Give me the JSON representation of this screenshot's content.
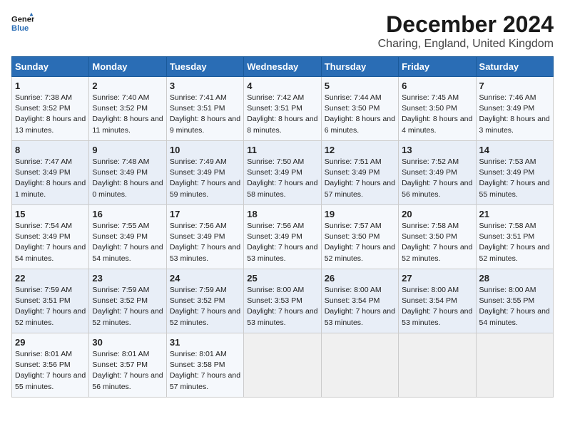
{
  "logo": {
    "line1": "General",
    "line2": "Blue"
  },
  "title": "December 2024",
  "location": "Charing, England, United Kingdom",
  "days_of_week": [
    "Sunday",
    "Monday",
    "Tuesday",
    "Wednesday",
    "Thursday",
    "Friday",
    "Saturday"
  ],
  "weeks": [
    [
      {
        "day": 1,
        "sunrise": "7:38 AM",
        "sunset": "3:52 PM",
        "daylight": "8 hours and 13 minutes."
      },
      {
        "day": 2,
        "sunrise": "7:40 AM",
        "sunset": "3:52 PM",
        "daylight": "8 hours and 11 minutes."
      },
      {
        "day": 3,
        "sunrise": "7:41 AM",
        "sunset": "3:51 PM",
        "daylight": "8 hours and 9 minutes."
      },
      {
        "day": 4,
        "sunrise": "7:42 AM",
        "sunset": "3:51 PM",
        "daylight": "8 hours and 8 minutes."
      },
      {
        "day": 5,
        "sunrise": "7:44 AM",
        "sunset": "3:50 PM",
        "daylight": "8 hours and 6 minutes."
      },
      {
        "day": 6,
        "sunrise": "7:45 AM",
        "sunset": "3:50 PM",
        "daylight": "8 hours and 4 minutes."
      },
      {
        "day": 7,
        "sunrise": "7:46 AM",
        "sunset": "3:49 PM",
        "daylight": "8 hours and 3 minutes."
      }
    ],
    [
      {
        "day": 8,
        "sunrise": "7:47 AM",
        "sunset": "3:49 PM",
        "daylight": "8 hours and 1 minute."
      },
      {
        "day": 9,
        "sunrise": "7:48 AM",
        "sunset": "3:49 PM",
        "daylight": "8 hours and 0 minutes."
      },
      {
        "day": 10,
        "sunrise": "7:49 AM",
        "sunset": "3:49 PM",
        "daylight": "7 hours and 59 minutes."
      },
      {
        "day": 11,
        "sunrise": "7:50 AM",
        "sunset": "3:49 PM",
        "daylight": "7 hours and 58 minutes."
      },
      {
        "day": 12,
        "sunrise": "7:51 AM",
        "sunset": "3:49 PM",
        "daylight": "7 hours and 57 minutes."
      },
      {
        "day": 13,
        "sunrise": "7:52 AM",
        "sunset": "3:49 PM",
        "daylight": "7 hours and 56 minutes."
      },
      {
        "day": 14,
        "sunrise": "7:53 AM",
        "sunset": "3:49 PM",
        "daylight": "7 hours and 55 minutes."
      }
    ],
    [
      {
        "day": 15,
        "sunrise": "7:54 AM",
        "sunset": "3:49 PM",
        "daylight": "7 hours and 54 minutes."
      },
      {
        "day": 16,
        "sunrise": "7:55 AM",
        "sunset": "3:49 PM",
        "daylight": "7 hours and 54 minutes."
      },
      {
        "day": 17,
        "sunrise": "7:56 AM",
        "sunset": "3:49 PM",
        "daylight": "7 hours and 53 minutes."
      },
      {
        "day": 18,
        "sunrise": "7:56 AM",
        "sunset": "3:49 PM",
        "daylight": "7 hours and 53 minutes."
      },
      {
        "day": 19,
        "sunrise": "7:57 AM",
        "sunset": "3:50 PM",
        "daylight": "7 hours and 52 minutes."
      },
      {
        "day": 20,
        "sunrise": "7:58 AM",
        "sunset": "3:50 PM",
        "daylight": "7 hours and 52 minutes."
      },
      {
        "day": 21,
        "sunrise": "7:58 AM",
        "sunset": "3:51 PM",
        "daylight": "7 hours and 52 minutes."
      }
    ],
    [
      {
        "day": 22,
        "sunrise": "7:59 AM",
        "sunset": "3:51 PM",
        "daylight": "7 hours and 52 minutes."
      },
      {
        "day": 23,
        "sunrise": "7:59 AM",
        "sunset": "3:52 PM",
        "daylight": "7 hours and 52 minutes."
      },
      {
        "day": 24,
        "sunrise": "7:59 AM",
        "sunset": "3:52 PM",
        "daylight": "7 hours and 52 minutes."
      },
      {
        "day": 25,
        "sunrise": "8:00 AM",
        "sunset": "3:53 PM",
        "daylight": "7 hours and 53 minutes."
      },
      {
        "day": 26,
        "sunrise": "8:00 AM",
        "sunset": "3:54 PM",
        "daylight": "7 hours and 53 minutes."
      },
      {
        "day": 27,
        "sunrise": "8:00 AM",
        "sunset": "3:54 PM",
        "daylight": "7 hours and 53 minutes."
      },
      {
        "day": 28,
        "sunrise": "8:00 AM",
        "sunset": "3:55 PM",
        "daylight": "7 hours and 54 minutes."
      }
    ],
    [
      {
        "day": 29,
        "sunrise": "8:01 AM",
        "sunset": "3:56 PM",
        "daylight": "7 hours and 55 minutes."
      },
      {
        "day": 30,
        "sunrise": "8:01 AM",
        "sunset": "3:57 PM",
        "daylight": "7 hours and 56 minutes."
      },
      {
        "day": 31,
        "sunrise": "8:01 AM",
        "sunset": "3:58 PM",
        "daylight": "7 hours and 57 minutes."
      },
      null,
      null,
      null,
      null
    ]
  ]
}
